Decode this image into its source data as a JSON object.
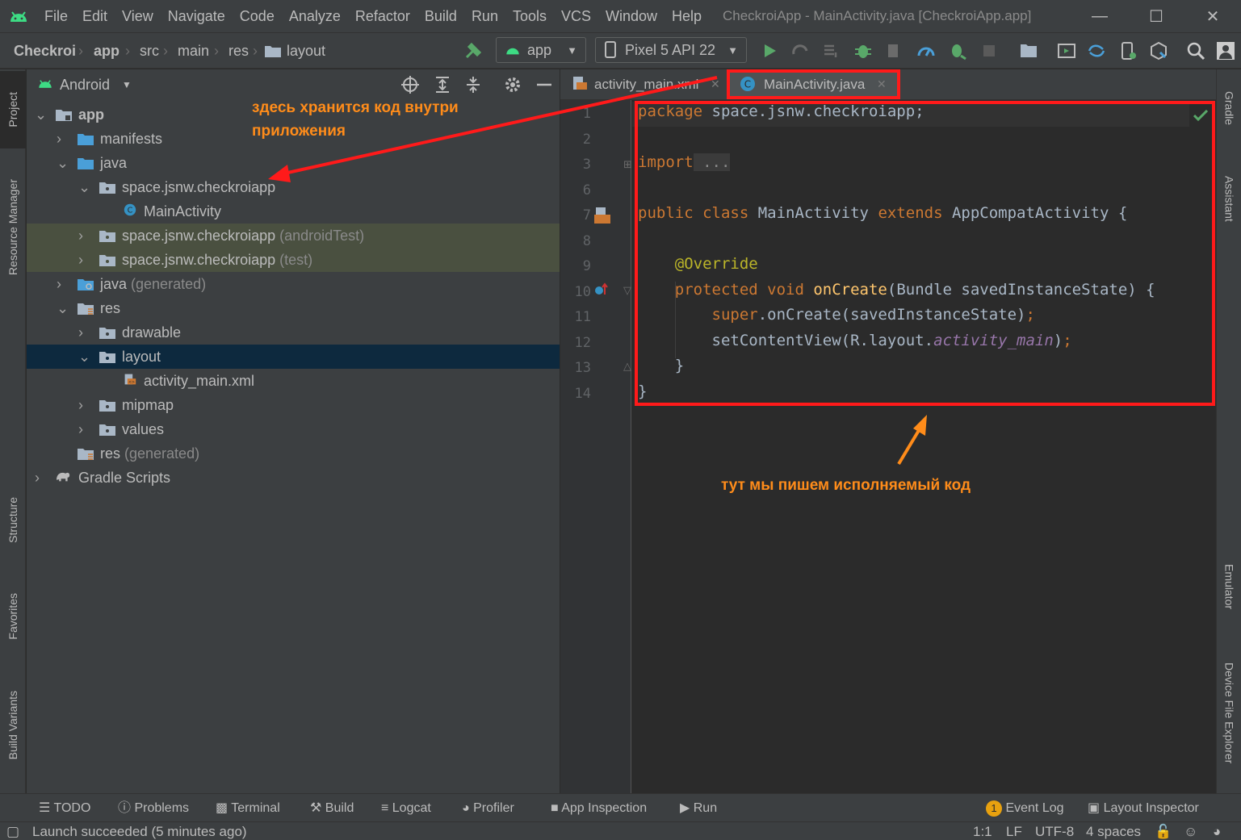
{
  "menubar": {
    "items": [
      "File",
      "Edit",
      "View",
      "Navigate",
      "Code",
      "Analyze",
      "Refactor",
      "Build",
      "Run",
      "Tools",
      "VCS",
      "Window",
      "Help"
    ],
    "window_title": "CheckroiApp - MainActivity.java [CheckroiApp.app]"
  },
  "navbar": {
    "breadcrumbs": [
      "Checkroi",
      "app",
      "src",
      "main",
      "res",
      "layout"
    ],
    "run_config": "app",
    "device": "Pixel 5 API 22"
  },
  "left_tools": [
    "Project",
    "Resource Manager",
    "Structure",
    "Favorites",
    "Build Variants"
  ],
  "right_tools": [
    "Gradle",
    "Assistant",
    "Emulator",
    "Device File Explorer"
  ],
  "project": {
    "view": "Android",
    "tree": [
      {
        "label": "app",
        "muted": ""
      },
      {
        "label": "manifests",
        "muted": ""
      },
      {
        "label": "java",
        "muted": ""
      },
      {
        "label": "space.jsnw.checkroiapp",
        "muted": ""
      },
      {
        "label": "MainActivity",
        "muted": ""
      },
      {
        "label": "space.jsnw.checkroiapp",
        "muted": " (androidTest)"
      },
      {
        "label": "space.jsnw.checkroiapp",
        "muted": " (test)"
      },
      {
        "label": "java",
        "muted": " (generated)"
      },
      {
        "label": "res",
        "muted": ""
      },
      {
        "label": "drawable",
        "muted": ""
      },
      {
        "label": "layout",
        "muted": ""
      },
      {
        "label": "activity_main.xml",
        "muted": ""
      },
      {
        "label": "mipmap",
        "muted": ""
      },
      {
        "label": "values",
        "muted": ""
      },
      {
        "label": "res",
        "muted": " (generated)"
      },
      {
        "label": "Gradle Scripts",
        "muted": ""
      }
    ]
  },
  "editor": {
    "tabs": [
      "activity_main.xml",
      "MainActivity.java"
    ],
    "line_numbers": [
      "1",
      "2",
      "3",
      "6",
      "7",
      "8",
      "9",
      "10",
      "11",
      "12",
      "13",
      "14"
    ],
    "code": {
      "l1_kw": "package",
      "l1_rest": " space.jsnw.checkroiapp;",
      "l3_kw": "import",
      "l3_rest": " ...",
      "l7_kw1": "public class",
      "l7_name": " MainActivity ",
      "l7_kw2": "extends",
      "l7_rest": " AppCompatActivity {",
      "l9_ann": "@Override",
      "l10_kw": "protected void",
      "l10_fn": " onCreate",
      "l10_rest": "(Bundle savedInstanceState) {",
      "l11_kw": "super",
      "l11_rest": ".onCreate(savedInstanceState)",
      "l11_semi": ";",
      "l12_a": "setContentView(R.layout.",
      "l12_b": "activity_main",
      "l12_c": ")",
      "l12_semi": ";",
      "l13": "}",
      "l14": "}"
    }
  },
  "annotations": {
    "project_note": "здесь хранится код внутри приложения",
    "editor_note": "тут мы пишем исполняемый код"
  },
  "bottom_tools": [
    "TODO",
    "Problems",
    "Terminal",
    "Build",
    "Logcat",
    "Profiler",
    "App Inspection",
    "Run",
    "Event Log",
    "Layout Inspector"
  ],
  "event_count": "1",
  "status": {
    "message": "Launch succeeded (5 minutes ago)",
    "position": "1:1",
    "line_sep": "LF",
    "encoding": "UTF-8",
    "indent": "4 spaces"
  },
  "colors": {
    "accent_android": "#3ddc84",
    "annotation_red": "#ff1a1a",
    "annotation_orange": "#ff8c1a"
  }
}
